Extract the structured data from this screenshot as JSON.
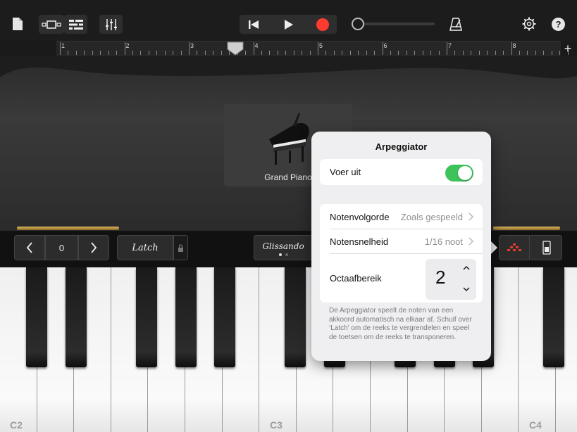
{
  "toolbar": {
    "icons": [
      "document-icon",
      "view-toggle-icon",
      "tracks-icon",
      "mixer-icon",
      "rewind-icon",
      "play-icon",
      "record-icon",
      "metronome-icon",
      "settings-icon",
      "help-icon"
    ],
    "help_label": "?",
    "record_color": "#ff3b30"
  },
  "ruler": {
    "bars": [
      "1",
      "2",
      "3",
      "4",
      "5",
      "6",
      "7",
      "8"
    ],
    "add_label": "+"
  },
  "instrument": {
    "name": "Grand Piano"
  },
  "controls": {
    "octave_value": "0",
    "latch_label": "Latch",
    "glissando_label": "Glissando"
  },
  "keyboard": {
    "labels": [
      "C2",
      "C3",
      "C4"
    ]
  },
  "arpeggiator": {
    "title": "Arpeggiator",
    "run_label": "Voer uit",
    "run_on": true,
    "order_label": "Notenvolgorde",
    "order_value": "Zoals gespeeld",
    "rate_label": "Notensnelheid",
    "rate_value": "1/16 noot",
    "range_label": "Octaafbereik",
    "range_value": "2",
    "description": "De Arpeggiator speelt de noten van een akkoord automatisch na elkaar af. Schuif over ‘Latch’ om de reeks te vergrendelen en speel de toetsen om de reeks te transponeren.",
    "accent": "#3ec25a"
  }
}
